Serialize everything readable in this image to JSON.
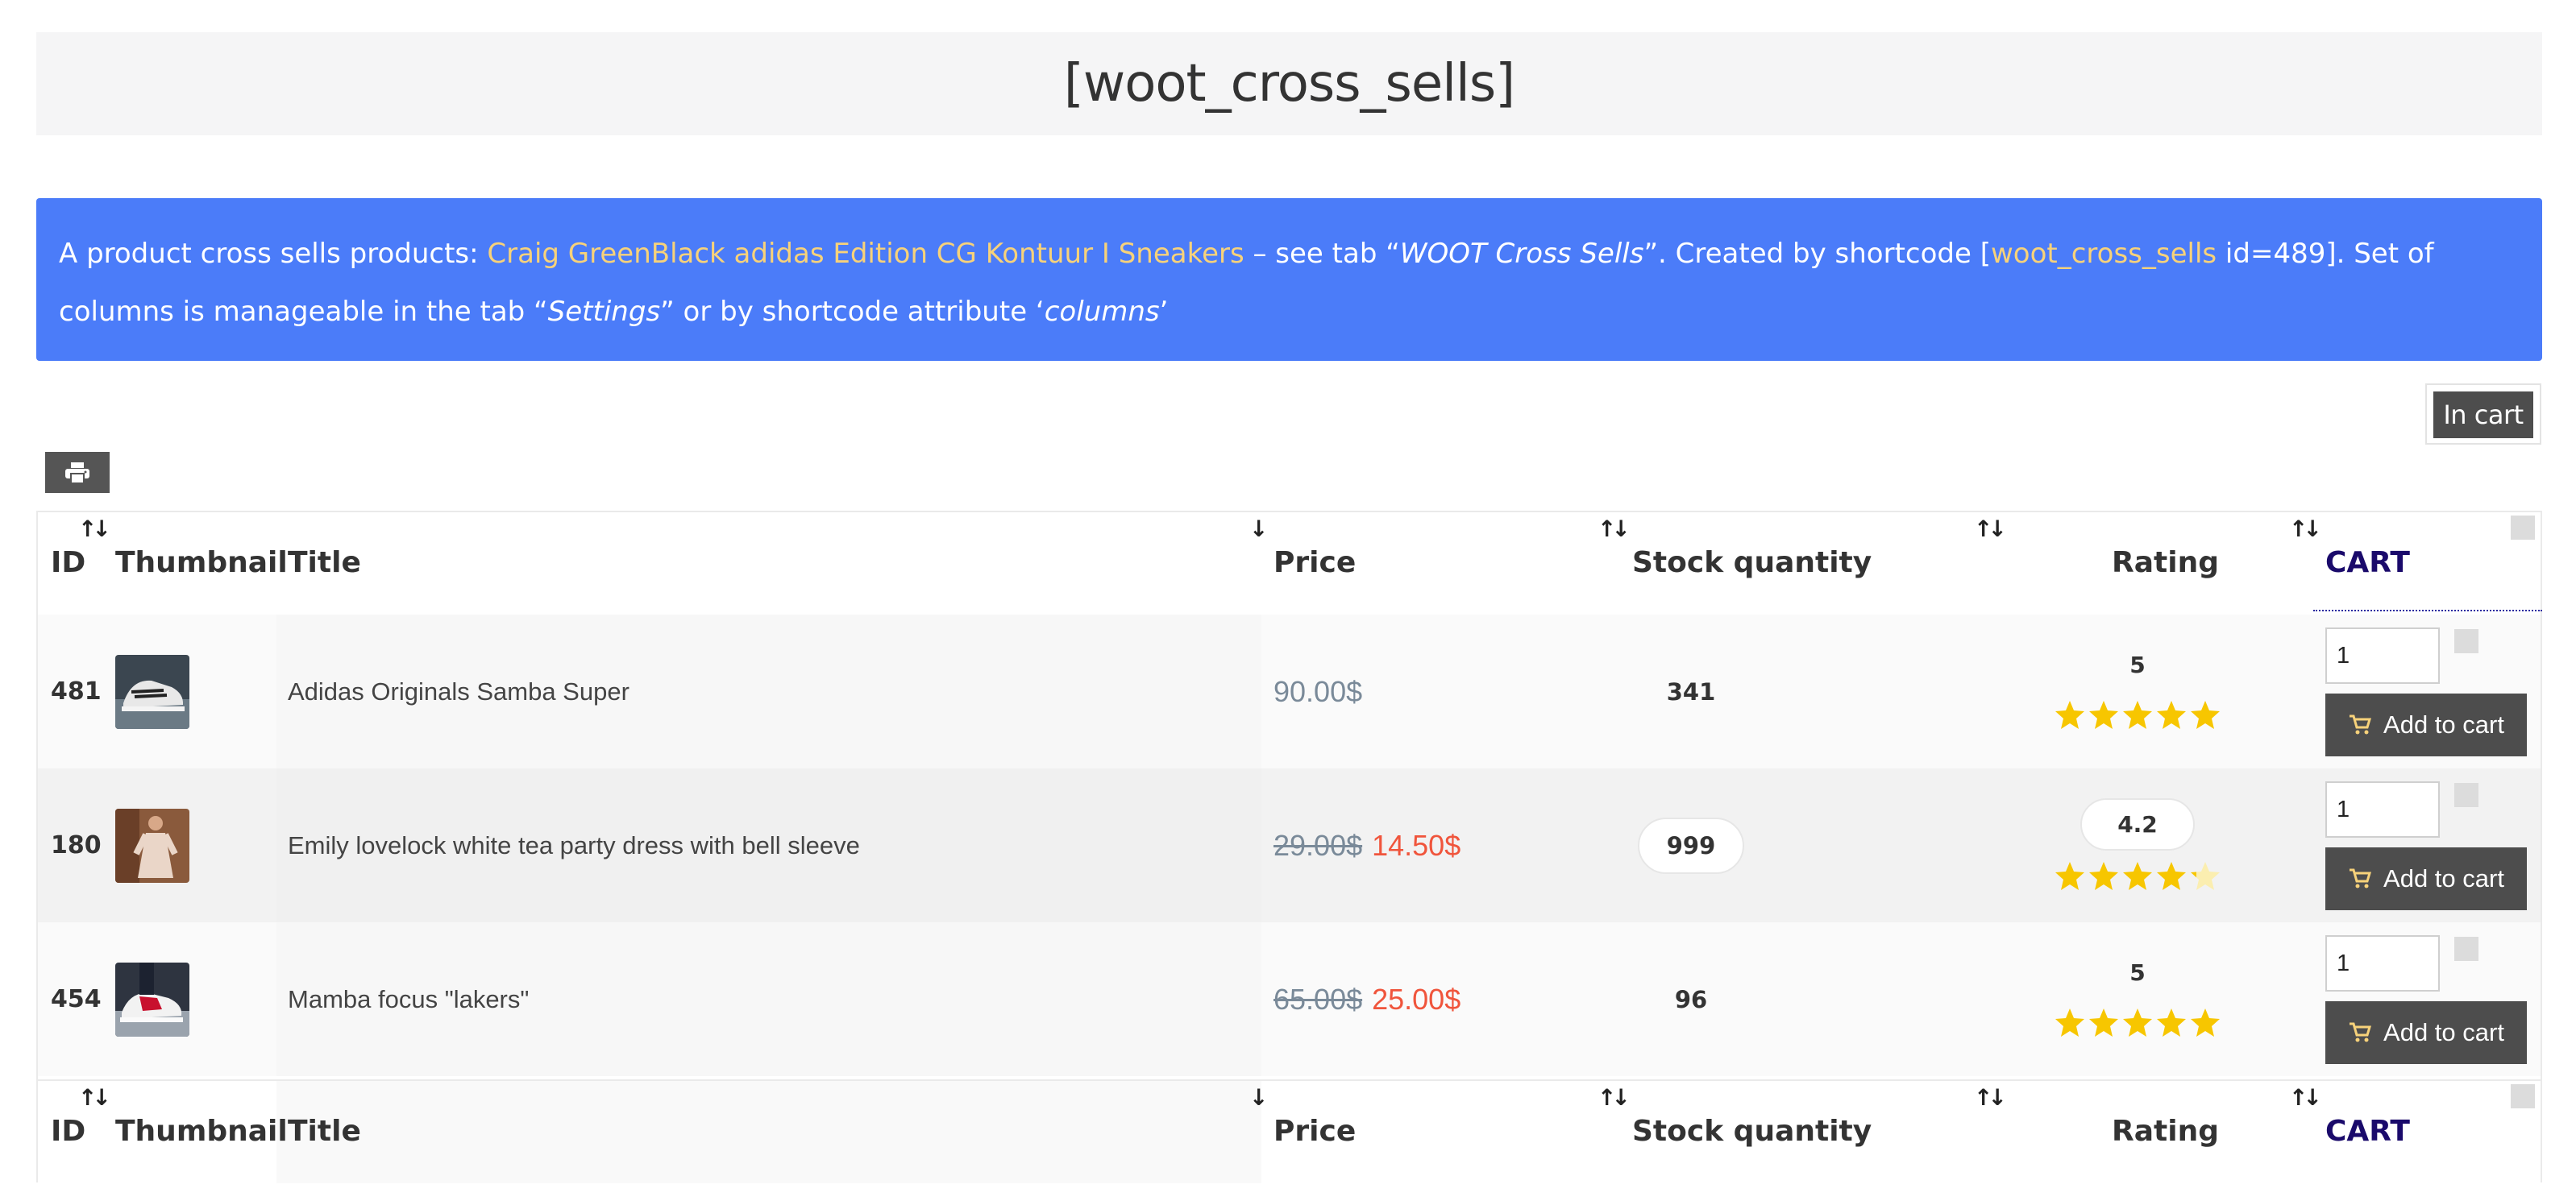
{
  "page_title": "[woot_cross_sells]",
  "info": {
    "text1": "A product cross sells products: ",
    "product_link": "Craig GreenBlack adidas Edition CG Kontuur I Sneakers",
    "text2": " – see tab “",
    "tab_name": "WOOT Cross Sells",
    "text3": "”. Created by shortcode [",
    "shortcode_link": "woot_cross_sells",
    "text4": " id=489]. Set of columns is manageable in the tab “",
    "settings": "Settings",
    "text5": "” or by shortcode attribute ‘",
    "attr": "columns",
    "text6": "’"
  },
  "in_cart_label": "In cart",
  "table": {
    "columns": {
      "id": "ID",
      "thumbnail": "Thumbnail",
      "title": "Title",
      "price": "Price",
      "stock": "Stock quantity",
      "rating": "Rating",
      "cart": "CART"
    },
    "sort_up_down": "↑↓",
    "sort_down": "↓",
    "rows": [
      {
        "id": "481",
        "title": "Adidas Originals Samba Super",
        "price": "90.00$",
        "old_price": "",
        "sale_price": "",
        "stock": "341",
        "rating": "5",
        "rating_value": 5,
        "qty": "1",
        "add_label": "Add to cart",
        "thumb_icon": "sneaker-photo"
      },
      {
        "id": "180",
        "title": "Emily lovelock white tea party dress with bell sleeve",
        "price": "",
        "old_price": "29.00$",
        "sale_price": "14.50$",
        "stock": "999",
        "rating": "4.2",
        "rating_value": 4.2,
        "qty": "1",
        "add_label": "Add to cart",
        "thumb_icon": "dress-photo"
      },
      {
        "id": "454",
        "title": "Mamba focus \"lakers\"",
        "price": "",
        "old_price": "65.00$",
        "sale_price": "25.00$",
        "stock": "96",
        "rating": "5",
        "rating_value": 5,
        "qty": "1",
        "add_label": "Add to cart",
        "thumb_icon": "sneaker-photo"
      }
    ]
  },
  "colors": {
    "info_bg": "#4b7cf9",
    "link": "#f7d27a",
    "sale": "#f0553c",
    "star": "#f7c600",
    "button": "#4d4d4d"
  }
}
